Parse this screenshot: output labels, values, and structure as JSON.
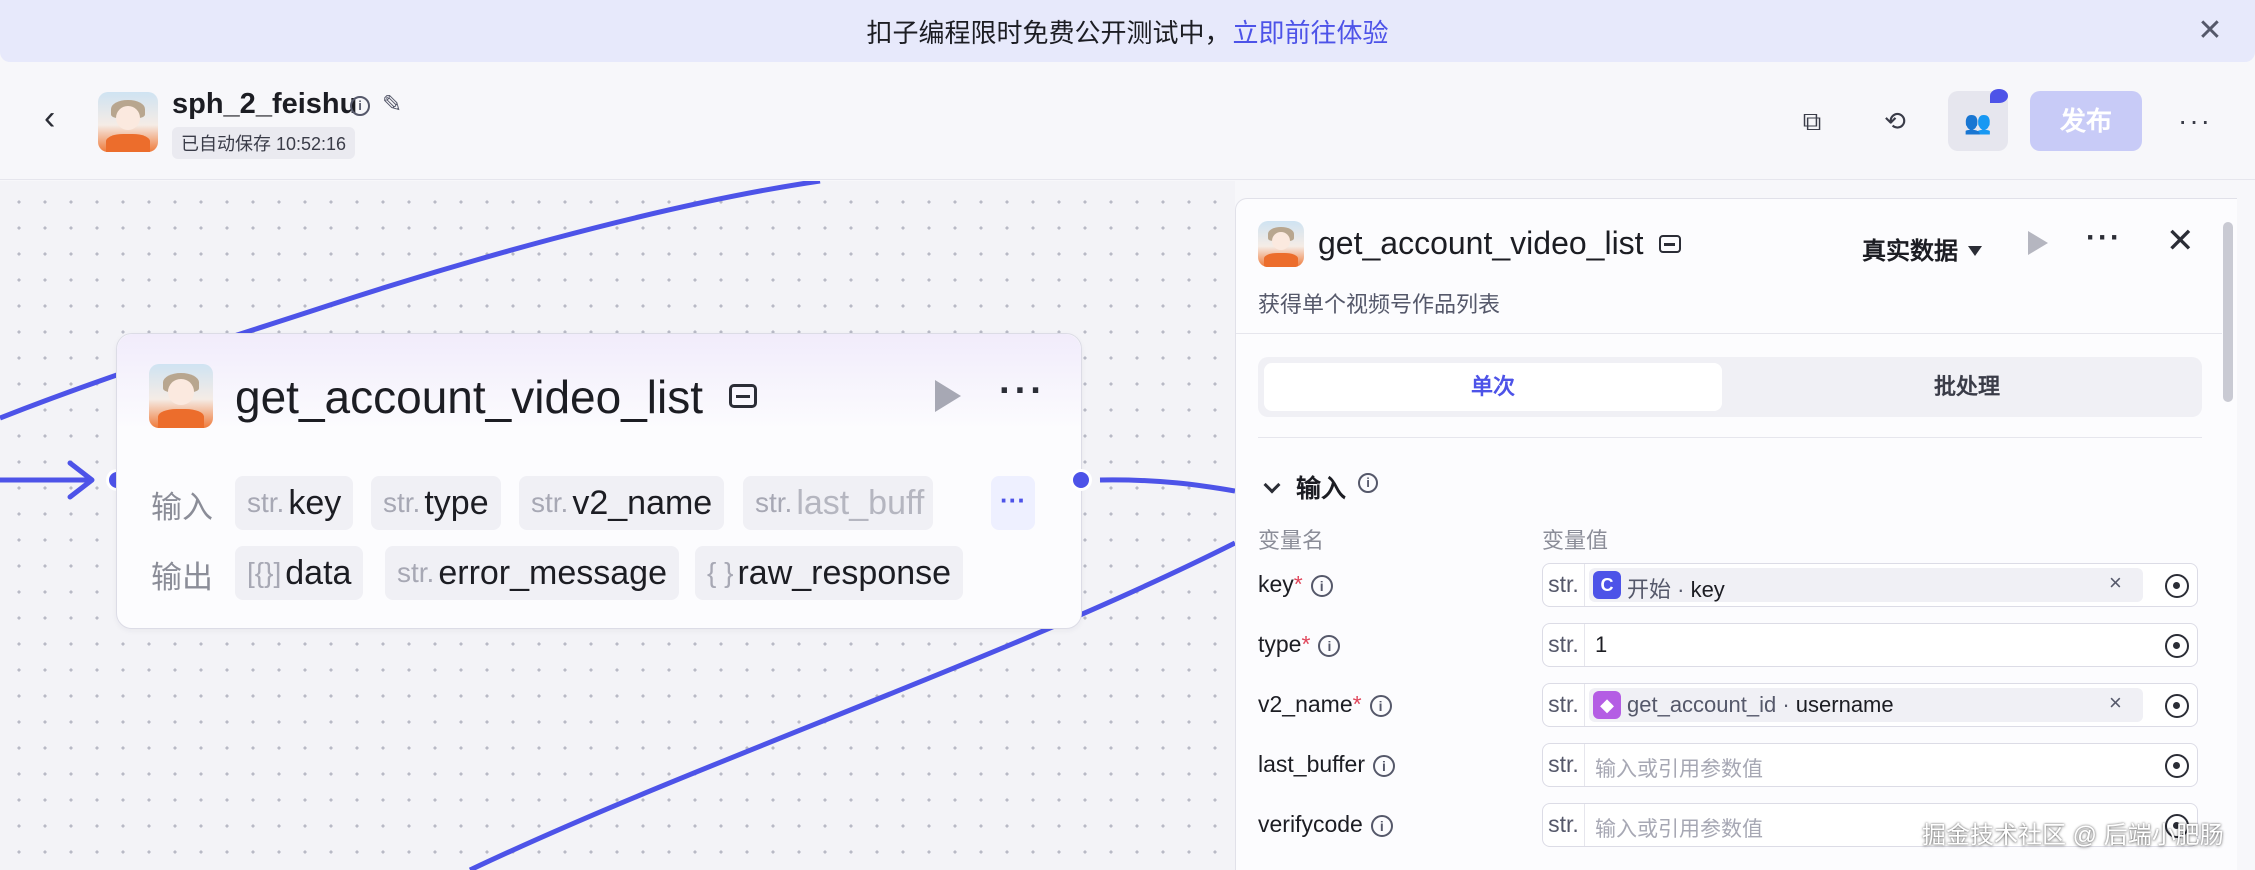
{
  "banner": {
    "text": "扣子编程限时免费公开测试中，",
    "link": "立即前往体验",
    "close_icon": "✕"
  },
  "header": {
    "back_icon": "‹",
    "title": "sph_2_feishu",
    "info_icon": "i",
    "edit_icon": "✎",
    "autosave": "已自动保存 10:52:16",
    "copy_icon": "⧉",
    "history_icon": "⟲",
    "collab_icon": "👥",
    "publish_label": "发布",
    "more_icon": "···"
  },
  "node": {
    "title": "get_account_video_list",
    "more_icon": "···",
    "input_label": "输入",
    "output_label": "输出",
    "inputs": [
      {
        "type": "str.",
        "name": "key"
      },
      {
        "type": "str.",
        "name": "type"
      },
      {
        "type": "str.",
        "name": "v2_name"
      },
      {
        "type": "str.",
        "name": "last_buff"
      }
    ],
    "inputs_more": "···",
    "outputs": [
      {
        "type": "[{}]",
        "name": "data"
      },
      {
        "type": "str.",
        "name": "error_message"
      },
      {
        "type": "{ }",
        "name": "raw_response"
      }
    ]
  },
  "panel": {
    "title": "get_account_video_list",
    "real_data_label": "真实数据",
    "more_icon": "···",
    "close_icon": "✕",
    "description": "获得单个视频号作品列表",
    "tabs": {
      "single": "单次",
      "batch": "批处理"
    },
    "section_title": "输入",
    "info_icon": "i",
    "col_name": "变量名",
    "col_value": "变量值",
    "fields": [
      {
        "name": "key",
        "required": "*",
        "type": "str.",
        "ref_icon": "C",
        "ref_source": "开始 · ",
        "ref_var": "key",
        "clear": "×"
      },
      {
        "name": "type",
        "required": "*",
        "type": "str.",
        "value": "1"
      },
      {
        "name": "v2_name",
        "required": "*",
        "type": "str.",
        "ref_icon": "◆",
        "ref_source": "get_account_id · ",
        "ref_var": "username",
        "clear": "×"
      },
      {
        "name": "last_buffer",
        "required": "",
        "type": "str.",
        "placeholder": "输入或引用参数值"
      },
      {
        "name": "verifycode",
        "required": "",
        "type": "str.",
        "placeholder": "输入或引用参数值"
      }
    ]
  },
  "watermark": "掘金技术社区 @ 后端小肥肠",
  "colors": {
    "accent": "#4d53e8",
    "banner_bg": "#e7e9fb",
    "publish_disabled": "#c8cbf7",
    "required": "#e0455a",
    "plugin_icon": "#b45de4"
  }
}
